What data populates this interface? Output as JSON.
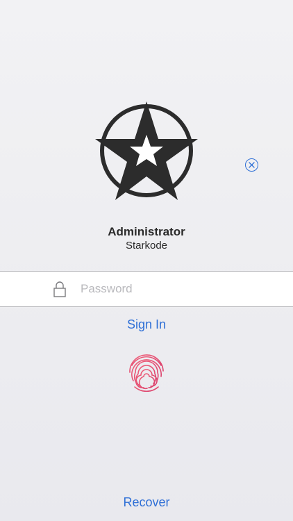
{
  "icons": {
    "logo": "star-in-circle-logo",
    "close": "close-circle-icon",
    "lock": "lock-icon",
    "fingerprint": "fingerprint-icon"
  },
  "user": {
    "name": "Administrator",
    "organization": "Starkode"
  },
  "password_field": {
    "placeholder": "Password",
    "value": ""
  },
  "actions": {
    "sign_in_label": "Sign In",
    "recover_label": "Recover"
  },
  "colors": {
    "accent": "#2e6fd6",
    "fingerprint": "#e04a73",
    "logo": "#2c2c2c"
  }
}
